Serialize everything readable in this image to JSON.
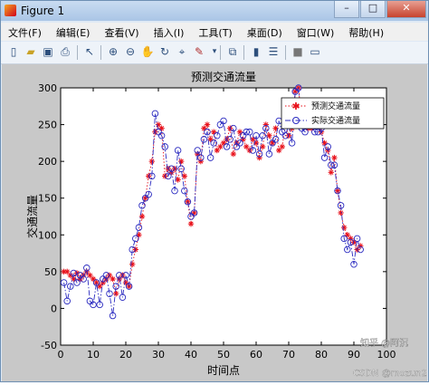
{
  "window": {
    "title": "Figure 1",
    "controls": [
      "–",
      "□",
      "✕"
    ]
  },
  "menu": [
    "文件(F)",
    "编辑(E)",
    "查看(V)",
    "插入(I)",
    "工具(T)",
    "桌面(D)",
    "窗口(W)",
    "帮助(H)"
  ],
  "toolbar_icons": [
    "new-figure-icon",
    "open-file-icon",
    "save-icon",
    "print-icon",
    "arrow-select-icon",
    "zoom-in-icon",
    "zoom-out-icon",
    "pan-icon",
    "rotate-3d-icon",
    "data-cursor-icon",
    "brush-icon",
    "link-plot-icon",
    "insert-colorbar-icon",
    "insert-legend-icon",
    "hide-plot-tools-icon",
    "show-plot-tools-icon"
  ],
  "watermark": "CSDN @mozun2020",
  "logo_text": "知乎 @阿沉",
  "chart_data": {
    "type": "line",
    "title": "预测交通流量",
    "xlabel": "时间点",
    "ylabel": "交通流量",
    "xlim": [
      0,
      100
    ],
    "ylim": [
      -50,
      300
    ],
    "xticks": [
      "0",
      "10",
      "20",
      "30",
      "40",
      "50",
      "60",
      "70",
      "80",
      "90",
      "100"
    ],
    "yticks": [
      "-50",
      "0",
      "50",
      "100",
      "150",
      "200",
      "250",
      "300"
    ],
    "legend_position": "top-right",
    "grid": false,
    "series": [
      {
        "name": "预测交通流量",
        "color": "#e8101a",
        "marker": "asterisk",
        "line": "dotted",
        "x": [
          1,
          2,
          3,
          4,
          5,
          6,
          7,
          8,
          9,
          10,
          11,
          12,
          13,
          14,
          15,
          16,
          17,
          18,
          19,
          20,
          21,
          22,
          23,
          24,
          25,
          26,
          27,
          28,
          29,
          30,
          31,
          32,
          33,
          34,
          35,
          36,
          37,
          38,
          39,
          40,
          41,
          42,
          43,
          44,
          45,
          46,
          47,
          48,
          49,
          50,
          51,
          52,
          53,
          54,
          55,
          56,
          57,
          58,
          59,
          60,
          61,
          62,
          63,
          64,
          65,
          66,
          67,
          68,
          69,
          70,
          71,
          72,
          73,
          74,
          75,
          76,
          77,
          78,
          79,
          80,
          81,
          82,
          83,
          84,
          85,
          86,
          87,
          88,
          89,
          90,
          91,
          92
        ],
        "values": [
          50,
          50,
          45,
          40,
          48,
          40,
          45,
          50,
          45,
          40,
          35,
          30,
          35,
          40,
          45,
          40,
          20,
          40,
          45,
          35,
          30,
          60,
          80,
          100,
          125,
          150,
          180,
          200,
          240,
          250,
          245,
          180,
          190,
          185,
          190,
          175,
          200,
          180,
          145,
          115,
          130,
          210,
          200,
          245,
          250,
          230,
          240,
          215,
          220,
          225,
          230,
          245,
          210,
          225,
          240,
          230,
          220,
          215,
          230,
          225,
          205,
          220,
          250,
          235,
          225,
          245,
          215,
          220,
          250,
          235,
          245,
          295,
          300,
          255,
          250,
          245,
          245,
          250,
          250,
          240,
          225,
          215,
          185,
          205,
          160,
          130,
          110,
          100,
          95,
          90,
          80,
          85
        ]
      },
      {
        "name": "实际交通流量",
        "color": "#2b2bc0",
        "marker": "circle",
        "line": "dashdot",
        "x": [
          1,
          2,
          3,
          4,
          5,
          6,
          7,
          8,
          9,
          10,
          11,
          12,
          13,
          14,
          15,
          16,
          17,
          18,
          19,
          20,
          21,
          22,
          23,
          24,
          25,
          26,
          27,
          28,
          29,
          30,
          31,
          32,
          33,
          34,
          35,
          36,
          37,
          38,
          39,
          40,
          41,
          42,
          43,
          44,
          45,
          46,
          47,
          48,
          49,
          50,
          51,
          52,
          53,
          54,
          55,
          56,
          57,
          58,
          59,
          60,
          61,
          62,
          63,
          64,
          65,
          66,
          67,
          68,
          69,
          70,
          71,
          72,
          73,
          74,
          75,
          76,
          77,
          78,
          79,
          80,
          81,
          82,
          83,
          84,
          85,
          86,
          87,
          88,
          89,
          90,
          91,
          92
        ],
        "values": [
          35,
          10,
          30,
          48,
          35,
          45,
          40,
          55,
          10,
          5,
          35,
          5,
          40,
          45,
          20,
          -10,
          30,
          45,
          15,
          45,
          30,
          80,
          95,
          110,
          140,
          150,
          155,
          180,
          265,
          240,
          235,
          220,
          180,
          190,
          160,
          215,
          190,
          160,
          145,
          125,
          130,
          215,
          205,
          230,
          240,
          205,
          225,
          235,
          250,
          255,
          220,
          230,
          245,
          220,
          225,
          235,
          240,
          240,
          215,
          235,
          210,
          235,
          245,
          210,
          225,
          230,
          255,
          240,
          235,
          250,
          225,
          295,
          300,
          245,
          240,
          250,
          250,
          240,
          240,
          245,
          205,
          220,
          195,
          195,
          160,
          140,
          95,
          80,
          90,
          60,
          95,
          80
        ]
      }
    ]
  }
}
